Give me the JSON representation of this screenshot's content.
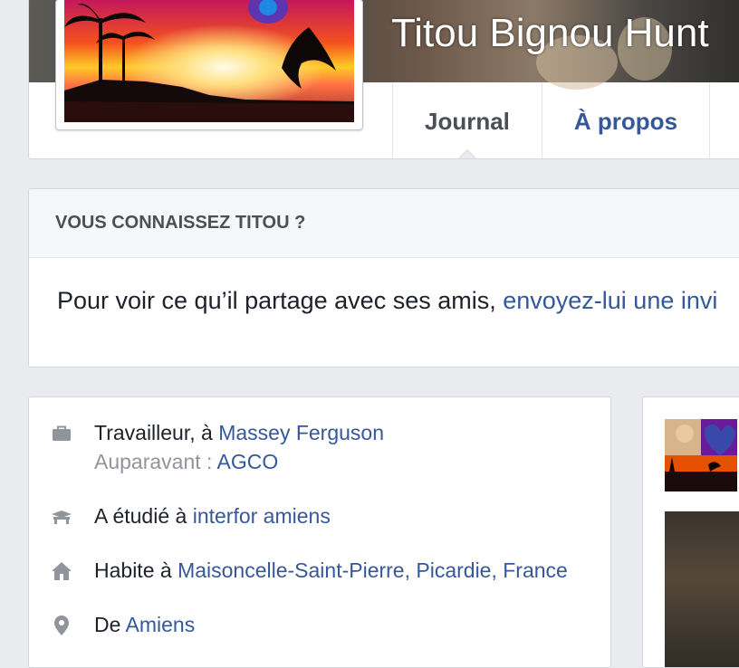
{
  "profile": {
    "name": "Titou Bignou Hunt",
    "tabs": [
      {
        "label": "Journal",
        "active": true
      },
      {
        "label": "À propos",
        "active": false
      }
    ]
  },
  "know_card": {
    "heading": "VOUS CONNAISSEZ TITOU ?",
    "text": "Pour voir ce qu’il partage avec ses amis, ",
    "link": "envoyez-lui une invi"
  },
  "intro": {
    "work": {
      "prefix": "Travailleur, à ",
      "company": "Massey Ferguson",
      "previous_prefix": "Auparavant : ",
      "previous_company": "AGCO",
      "icon": "briefcase-icon"
    },
    "education": {
      "prefix": "A étudié à ",
      "school": "interfor amiens",
      "icon": "graduation-cap-icon"
    },
    "home": {
      "prefix": "Habite à ",
      "place": "Maisoncelle-Saint-Pierre, Picardie, France",
      "icon": "house-icon"
    },
    "origin": {
      "prefix": "De ",
      "place": "Amiens",
      "icon": "map-pin-icon"
    }
  },
  "colors": {
    "link": "#365899",
    "background": "#e9ebee",
    "muted": "#90949c",
    "text": "#1d2129"
  }
}
